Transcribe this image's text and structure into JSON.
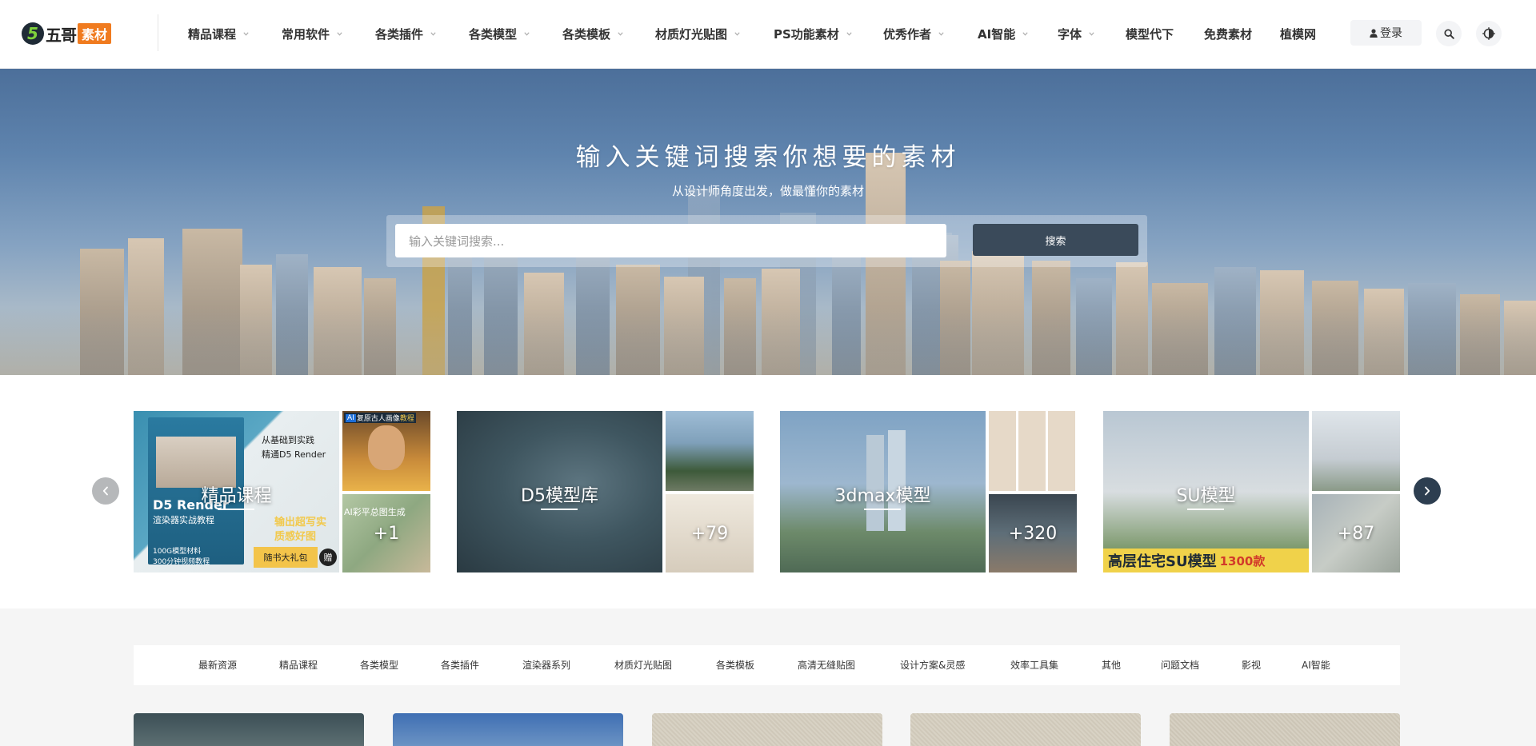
{
  "header": {
    "logo": {
      "mark": "5",
      "text": "五哥",
      "badge": "素材"
    },
    "nav": [
      {
        "label": "精品课程",
        "dropdown": true
      },
      {
        "label": "常用软件",
        "dropdown": true
      },
      {
        "label": "各类插件",
        "dropdown": true
      },
      {
        "label": "各类模型",
        "dropdown": true
      },
      {
        "label": "各类模板",
        "dropdown": true
      },
      {
        "label": "材质灯光贴图",
        "dropdown": true
      },
      {
        "label": "PS功能素材",
        "dropdown": true
      },
      {
        "label": "优秀作者",
        "dropdown": true
      },
      {
        "label": "AI智能",
        "dropdown": true
      },
      {
        "label": "字体",
        "dropdown": true
      },
      {
        "label": "模型代下",
        "dropdown": false
      },
      {
        "label": "免费素材",
        "dropdown": false
      },
      {
        "label": "植模网",
        "dropdown": false
      }
    ],
    "login_label": "登录"
  },
  "hero": {
    "title": "输入关键词搜索你想要的素材",
    "subtitle": "从设计师角度出发，做最懂你的素材",
    "search_placeholder": "输入关键词搜索...",
    "search_button": "搜索"
  },
  "carousel": {
    "cards": [
      {
        "label": "精品课程",
        "count": "+1"
      },
      {
        "label": "D5模型库",
        "count": "+79"
      },
      {
        "label": "3dmax模型",
        "count": "+320"
      },
      {
        "label": "SU模型",
        "count": "+87"
      }
    ],
    "card_texts": {
      "book_line1": "从基础到实践",
      "book_line2": "精通D5 Render",
      "book_title": "D5 Render",
      "book_sub": "渲染器实战教程",
      "book_promo": "输出超写实",
      "book_promo2": "质感好图",
      "book_gift": "随书大礼包",
      "book_gift_badge": "赠",
      "book_footer1": "100G模型材料",
      "book_footer2": "300分钟视频教程",
      "ai_title_tag": "AI",
      "ai_title": "复原古人画像",
      "ai_title_suffix": "教程",
      "ai_title2": "AI彩平总图生成",
      "su_banner": "高层住宅SU模型",
      "su_banner_count": "1300款"
    }
  },
  "tabs": [
    "最新资源",
    "精品课程",
    "各类模型",
    "各类插件",
    "渲染器系列",
    "材质灯光贴图",
    "各类模板",
    "高清无缝贴图",
    "设计方案&灵感",
    "效率工具集",
    "其他",
    "问题文档",
    "影视",
    "AI智能"
  ],
  "colors": {
    "accent": "#f07b1f",
    "dark_button": "#3a4a5a",
    "arrow_active": "#2d3e50"
  },
  "icons": {
    "user": "user-icon",
    "search": "search-icon",
    "theme": "theme-toggle-icon",
    "prev": "chevron-left-icon",
    "next": "chevron-right-icon",
    "caret": "chevron-down-icon"
  }
}
